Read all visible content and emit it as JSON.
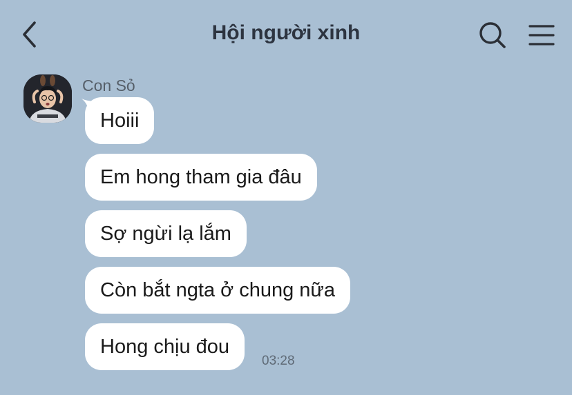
{
  "header": {
    "title": "Hội người xinh",
    "back_icon": "chevron-left-icon",
    "search_icon": "search-icon",
    "menu_icon": "hamburger-menu-icon"
  },
  "conversation": {
    "sender_name": "Con Sỏ",
    "messages": [
      {
        "text": "Hoiii"
      },
      {
        "text": "Em hong tham gia đâu"
      },
      {
        "text": "Sợ ngừi lạ lắm"
      },
      {
        "text": "Còn bắt ngta ở chung nữa"
      },
      {
        "text": "Hong chịu đou"
      }
    ],
    "last_timestamp": "03:28"
  },
  "colors": {
    "background": "#a9bfd3",
    "bubble": "#ffffff",
    "title_text": "#2d3440",
    "icon": "#2b2f36"
  }
}
